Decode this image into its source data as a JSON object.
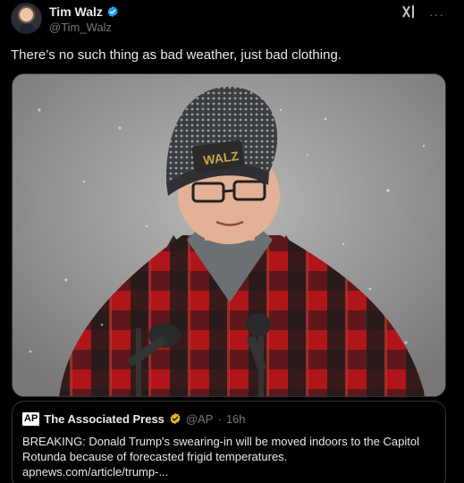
{
  "author": {
    "name": "Tim Walz",
    "handle": "@Tim_Walz"
  },
  "post": {
    "text": "There’s no such thing as bad weather, just bad clothing."
  },
  "actions": {
    "grok_icon": "grok-icon",
    "more_label": "···"
  },
  "media": {
    "hat_text": "WALZ"
  },
  "quote": {
    "logo": "AP",
    "name": "The Associated Press",
    "handle": "@AP",
    "separator": "·",
    "time": "16h",
    "text": "BREAKING: Donald Trump's swearing-in will be moved indoors to the Capitol Rotunda because of forecasted frigid temperatures.",
    "link": "apnews.com/article/trump-..."
  },
  "colors": {
    "background": "#000000",
    "verified_blue": "#1d9bf0",
    "verified_gold": "#e2b719",
    "secondary_text": "#71767b"
  }
}
